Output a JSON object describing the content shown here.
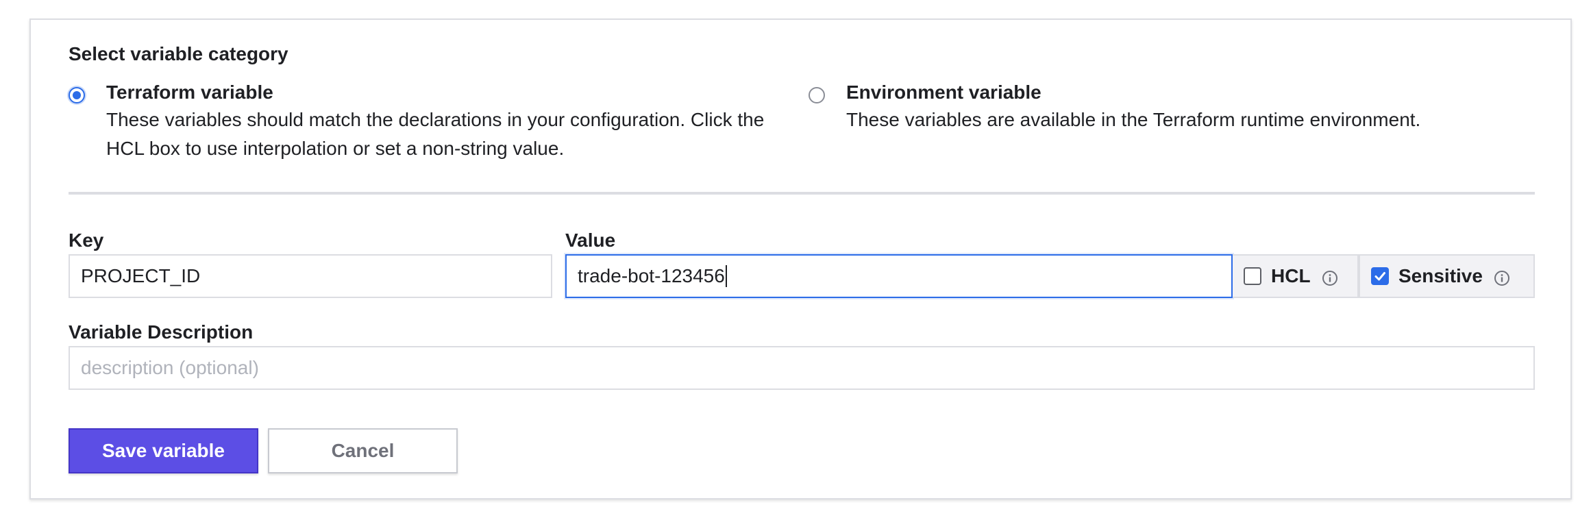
{
  "category": {
    "title": "Select variable category",
    "options": [
      {
        "label": "Terraform variable",
        "description_line1": "These variables should match the declarations in your configuration. Click the",
        "description_line2": "HCL box to use interpolation or set a non-string value.",
        "selected": true
      },
      {
        "label": "Environment variable",
        "description_line1": "These variables are available in the Terraform runtime environment.",
        "selected": false
      }
    ]
  },
  "form": {
    "key_label": "Key",
    "key_value": "PROJECT_ID",
    "value_label": "Value",
    "value_value": "trade-bot-123456",
    "hcl": {
      "label": "HCL",
      "checked": false
    },
    "sensitive": {
      "label": "Sensitive",
      "checked": true
    },
    "description_label": "Variable Description",
    "description_placeholder": "description (optional)",
    "description_value": ""
  },
  "actions": {
    "save_label": "Save variable",
    "cancel_label": "Cancel"
  },
  "colors": {
    "accent": "#2c6ce8",
    "primary_button": "#5c4ee5",
    "border": "#dcdde2"
  },
  "icons": {
    "info": "info-circle-icon",
    "check": "check-icon"
  }
}
